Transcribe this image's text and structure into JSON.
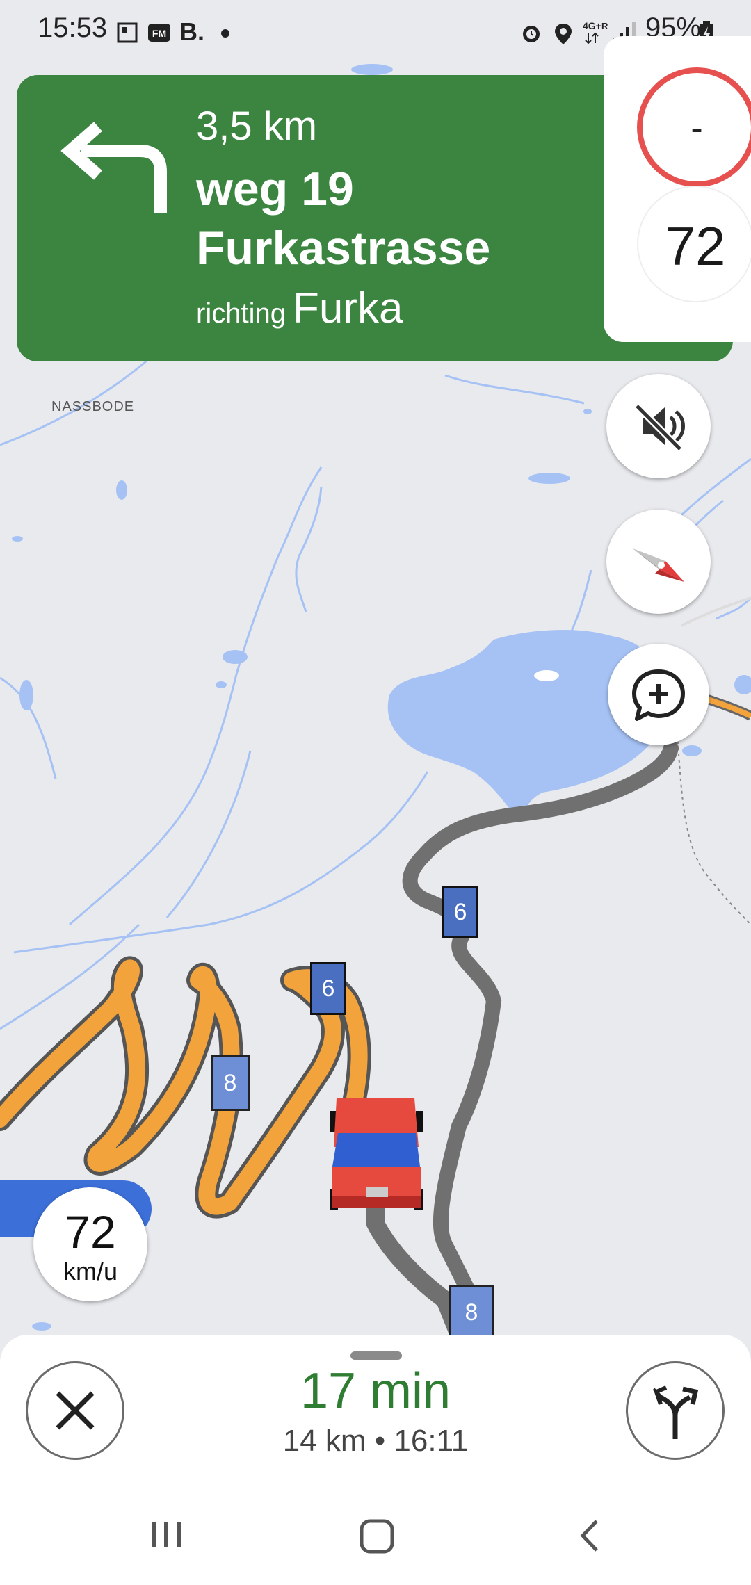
{
  "status_bar": {
    "time": "15:53",
    "network": "4G+ R",
    "battery": "95%"
  },
  "map": {
    "place_label": "NASSBODE",
    "shields": [
      "6",
      "6",
      "8",
      "8"
    ],
    "water_color": "#a6c2f5",
    "route_color": "#f2a33c",
    "passed_route_color": "#707070"
  },
  "navigation": {
    "distance": "3,5 km",
    "road": "weg 19",
    "street": "Furkastrasse",
    "direction_prefix": "richting",
    "direction_destination": "Furka",
    "banner_color": "#3c8541"
  },
  "speed_panel": {
    "limit_value": "-",
    "current_speed": "72"
  },
  "speedometer": {
    "value": "72",
    "unit": "km/u"
  },
  "trip": {
    "duration": "17 min",
    "details": "14 km  •  16:11"
  },
  "icons": {
    "turn": "turn-left-icon",
    "mute": "sound-off-icon",
    "compass": "compass-icon",
    "report": "add-report-icon",
    "close": "close-icon",
    "alternatives": "route-options-icon"
  }
}
